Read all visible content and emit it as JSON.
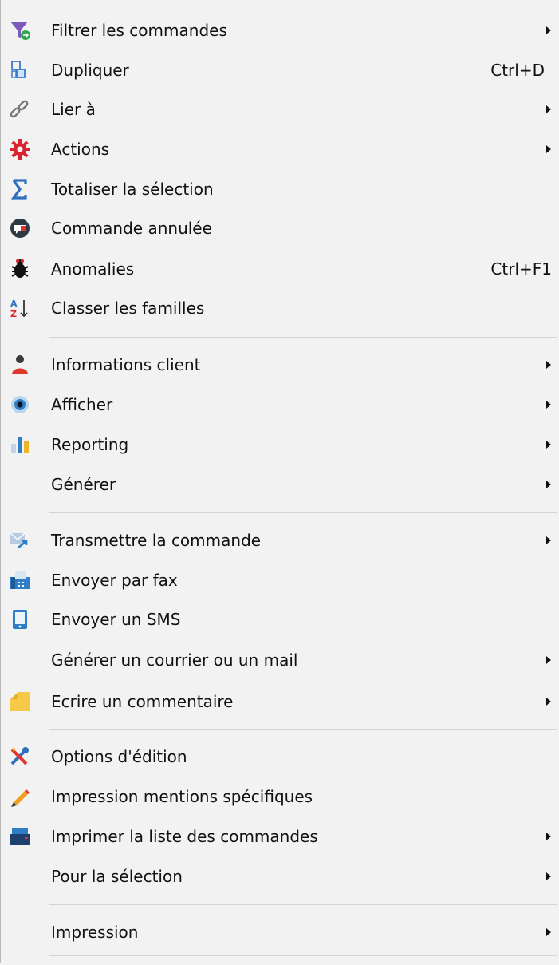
{
  "menu": {
    "items": [
      {
        "label": "Filtrer les commandes",
        "submenu": true,
        "icon": "funnel-icon"
      },
      {
        "label": "Dupliquer",
        "shortcut": "Ctrl+D",
        "icon": "duplicate-icon"
      },
      {
        "label": "Lier à",
        "submenu": true,
        "icon": "link-icon"
      },
      {
        "label": "Actions",
        "submenu": true,
        "icon": "gear-icon"
      },
      {
        "label": "Totaliser la sélection",
        "icon": "sigma-icon"
      },
      {
        "label": "Commande annulée",
        "icon": "cancel-order-icon"
      },
      {
        "label": "Anomalies",
        "shortcut": "Ctrl+F1",
        "icon": "bug-icon"
      },
      {
        "label": "Classer les familles",
        "icon": "sort-az-icon"
      },
      {
        "label": "Informations client",
        "submenu": true,
        "icon": "user-icon"
      },
      {
        "label": "Afficher",
        "submenu": true,
        "icon": "eye-icon"
      },
      {
        "label": "Reporting",
        "submenu": true,
        "icon": "bar-chart-icon"
      },
      {
        "label": "Générer",
        "submenu": true,
        "icon": ""
      },
      {
        "label": "Transmettre la commande",
        "submenu": true,
        "icon": "send-mail-icon"
      },
      {
        "label": "Envoyer par fax",
        "icon": "fax-icon"
      },
      {
        "label": "Envoyer un SMS",
        "icon": "phone-icon"
      },
      {
        "label": "Générer un courrier ou un mail",
        "submenu": true,
        "icon": ""
      },
      {
        "label": "Ecrire un commentaire",
        "submenu": true,
        "icon": "sticky-note-icon"
      },
      {
        "label": "Options d'édition",
        "icon": "tools-icon"
      },
      {
        "label": "Impression mentions spécifiques",
        "icon": "pencil-icon"
      },
      {
        "label": "Imprimer la liste des commandes",
        "submenu": true,
        "icon": "printer-icon"
      },
      {
        "label": "Pour la sélection",
        "submenu": true,
        "icon": ""
      },
      {
        "label": "Impression",
        "submenu": true,
        "icon": ""
      }
    ]
  }
}
